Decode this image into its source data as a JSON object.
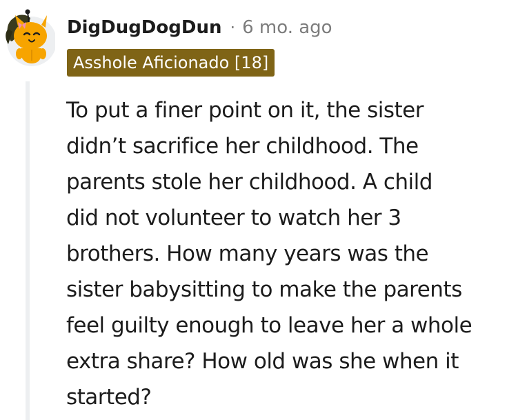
{
  "comment": {
    "username": "DigDugDogDun",
    "separator": "·",
    "timestamp": "6 mo. ago",
    "flair": "Asshole Aficionado [18]",
    "body": "To put a finer point on it, the sister\ndidn’t sacrifice her childhood. The\nparents stole her childhood. A child\ndid not volunteer to watch her 3\nbrothers. How many years was the\nsister babysitting to make the parents\nfeel guilty enough to leave her a whole\nextra share? How old was she when it\nstarted?"
  },
  "colors": {
    "flair_background": "#7f6416",
    "avatar_body": "#f7a400",
    "thread_line": "#edeff1",
    "meta_text": "#7c7c7c"
  },
  "icons": {
    "avatar": "snoo-avatar-icon"
  }
}
